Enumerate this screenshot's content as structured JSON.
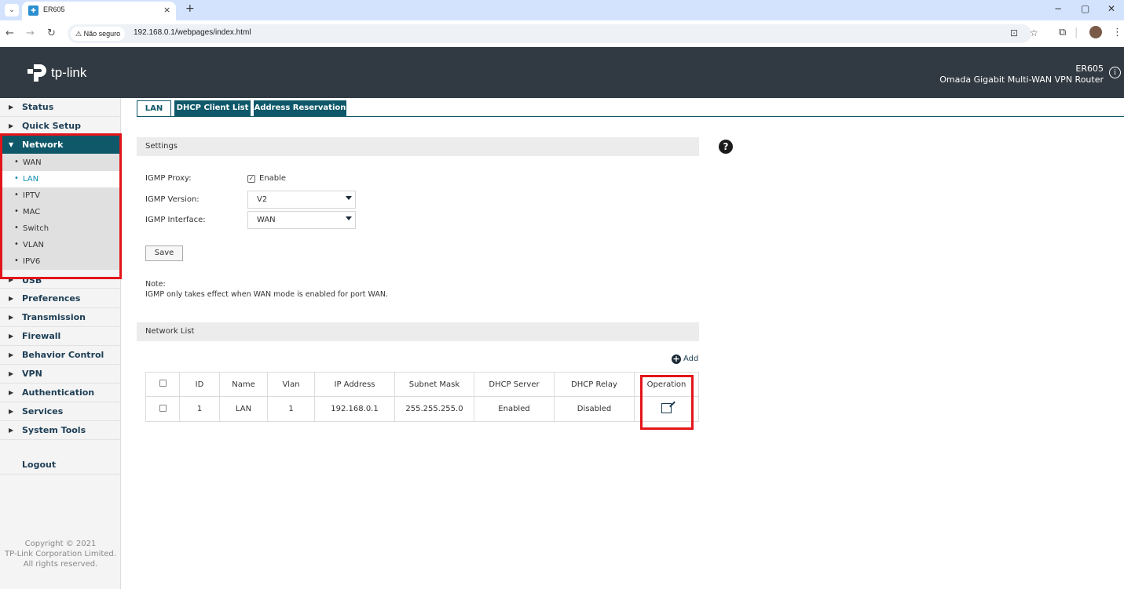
{
  "browser": {
    "tab_title": "ER605",
    "tab_close": "×",
    "new_tab": "+",
    "security_label": "⚠ Não seguro",
    "url": "192.168.0.1/webpages/index.html",
    "window_controls": [
      "−",
      "▢",
      "✕"
    ]
  },
  "header": {
    "logo_text": "tp-link",
    "model": "ER605",
    "subtitle": "Omada Gigabit Multi-WAN VPN Router",
    "info_icon": "i"
  },
  "sidebar": {
    "menu": [
      {
        "label": "Status",
        "caret": "▶"
      },
      {
        "label": "Quick Setup",
        "caret": "▶"
      },
      {
        "label": "Network",
        "caret": "▼"
      },
      {
        "label": "USB",
        "caret": "▶"
      },
      {
        "label": "Preferences",
        "caret": "▶"
      },
      {
        "label": "Transmission",
        "caret": "▶"
      },
      {
        "label": "Firewall",
        "caret": "▶"
      },
      {
        "label": "Behavior Control",
        "caret": "▶"
      },
      {
        "label": "VPN",
        "caret": "▶"
      },
      {
        "label": "Authentication",
        "caret": "▶"
      },
      {
        "label": "Services",
        "caret": "▶"
      },
      {
        "label": "System Tools",
        "caret": "▶"
      }
    ],
    "network_sub": [
      "WAN",
      "LAN",
      "IPTV",
      "MAC",
      "Switch",
      "VLAN",
      "IPV6"
    ],
    "logout": "Logout",
    "copyright": [
      "Copyright © 2021",
      "TP-Link Corporation Limited.",
      "All rights reserved."
    ]
  },
  "tabs": [
    "LAN",
    "DHCP Client List",
    "Address Reservation"
  ],
  "settings": {
    "title": "Settings",
    "igmp_proxy_label": "IGMP Proxy:",
    "igmp_proxy_check": "✓",
    "igmp_proxy_value": "Enable",
    "igmp_version_label": "IGMP Version:",
    "igmp_version_value": "V2",
    "igmp_interface_label": "IGMP Interface:",
    "igmp_interface_value": "WAN",
    "save": "Save",
    "note_title": "Note:",
    "note_text": "IGMP only takes effect when WAN mode is enabled for port WAN."
  },
  "network_list": {
    "title": "Network List",
    "add": "Add",
    "add_icon": "+",
    "columns": [
      "ID",
      "Name",
      "Vlan",
      "IP Address",
      "Subnet Mask",
      "DHCP Server",
      "DHCP Relay",
      "Operation"
    ],
    "rows": [
      {
        "id": "1",
        "name": "LAN",
        "vlan": "1",
        "ip": "192.168.0.1",
        "mask": "255.255.255.0",
        "dhcp_server": "Enabled",
        "dhcp_relay": "Disabled"
      }
    ]
  },
  "help_icon": "?",
  "colors": {
    "accent": "#0e5869",
    "header": "#313a42",
    "highlight": "#e3151a"
  }
}
